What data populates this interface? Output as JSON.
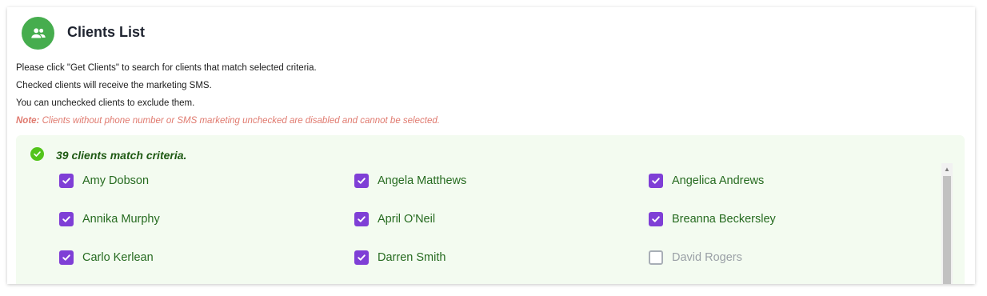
{
  "header": {
    "title": "Clients List",
    "icon": "group-icon",
    "icon_color": "#46ad4e"
  },
  "instructions": [
    "Please click \"Get Clients\" to search for clients that match selected criteria.",
    "Checked clients will receive the marketing SMS.",
    "You can unchecked clients to exclude them."
  ],
  "note": {
    "label": "Note:",
    "text": " Clients without phone number or SMS marketing unchecked are disabled and cannot be selected."
  },
  "results": {
    "summary": "39 clients match criteria.",
    "icon": "check-circle-icon",
    "accent": "#7f3fd6",
    "clients": [
      {
        "name": "Amy Dobson",
        "checked": true,
        "disabled": false
      },
      {
        "name": "Angela Matthews",
        "checked": true,
        "disabled": false
      },
      {
        "name": "Angelica Andrews",
        "checked": true,
        "disabled": false
      },
      {
        "name": "Annika Murphy",
        "checked": true,
        "disabled": false
      },
      {
        "name": "April O'Neil",
        "checked": true,
        "disabled": false
      },
      {
        "name": "Breanna Beckersley",
        "checked": true,
        "disabled": false
      },
      {
        "name": "Carlo Kerlean",
        "checked": true,
        "disabled": false
      },
      {
        "name": "Darren Smith",
        "checked": true,
        "disabled": false
      },
      {
        "name": "David Rogers",
        "checked": false,
        "disabled": true
      }
    ]
  }
}
